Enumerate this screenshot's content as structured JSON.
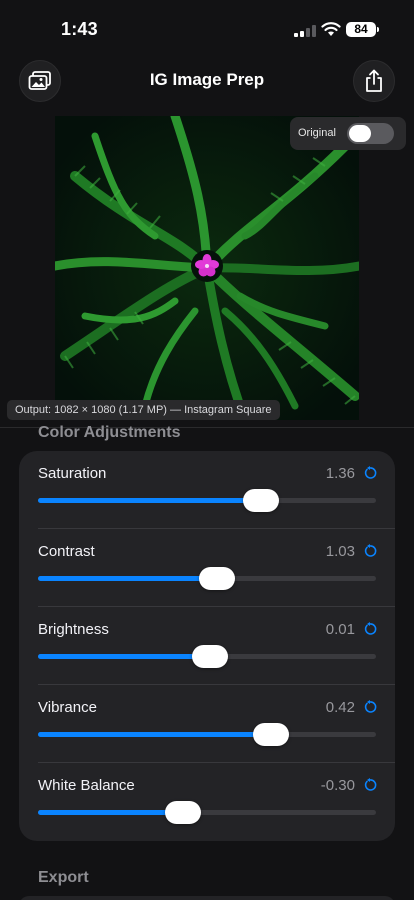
{
  "status": {
    "time": "1:43",
    "battery": "84"
  },
  "header": {
    "title": "IG Image Prep"
  },
  "preview": {
    "toggle_label": "Original",
    "toggle_on": false,
    "output_info": "Output: 1082 × 1080 (1.17 MP) — Instagram Square"
  },
  "sections": {
    "color": "Color Adjustments",
    "export": "Export"
  },
  "sliders": [
    {
      "label": "Saturation",
      "value": "1.36",
      "position": 0.66
    },
    {
      "label": "Contrast",
      "value": "1.03",
      "position": 0.53
    },
    {
      "label": "Brightness",
      "value": "0.01",
      "position": 0.51
    },
    {
      "label": "Vibrance",
      "value": "0.42",
      "position": 0.69
    },
    {
      "label": "White Balance",
      "value": "-0.30",
      "position": 0.43
    }
  ],
  "colors": {
    "accent": "#0a84ff",
    "panel": "#232326",
    "background": "#121214"
  }
}
